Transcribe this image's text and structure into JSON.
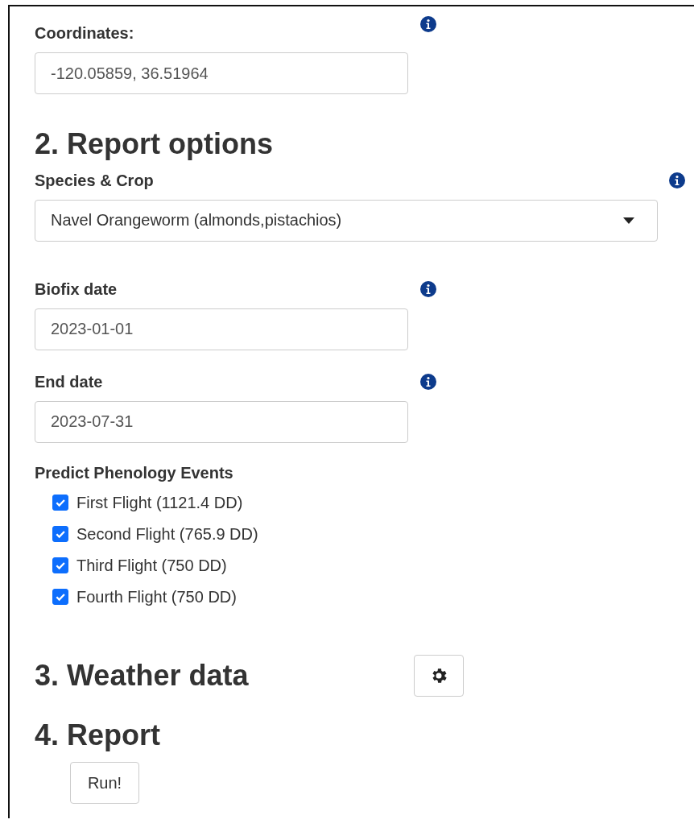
{
  "coordinates": {
    "label": "Coordinates:",
    "value": "-120.05859, 36.51964"
  },
  "report_options": {
    "heading": "2. Report options",
    "species": {
      "label": "Species & Crop",
      "value": "Navel Orangeworm (almonds,pistachios)"
    },
    "biofix": {
      "label": "Biofix date",
      "value": "2023-01-01"
    },
    "end_date": {
      "label": "End date",
      "value": "2023-07-31"
    },
    "events": {
      "label": "Predict Phenology Events",
      "items": [
        {
          "label": "First Flight (1121.4 DD)",
          "checked": true
        },
        {
          "label": "Second Flight (765.9 DD)",
          "checked": true
        },
        {
          "label": "Third Flight (750 DD)",
          "checked": true
        },
        {
          "label": "Fourth Flight (750 DD)",
          "checked": true
        }
      ]
    }
  },
  "weather": {
    "heading": "3. Weather data"
  },
  "report": {
    "heading": "4. Report",
    "button": "Run!"
  }
}
